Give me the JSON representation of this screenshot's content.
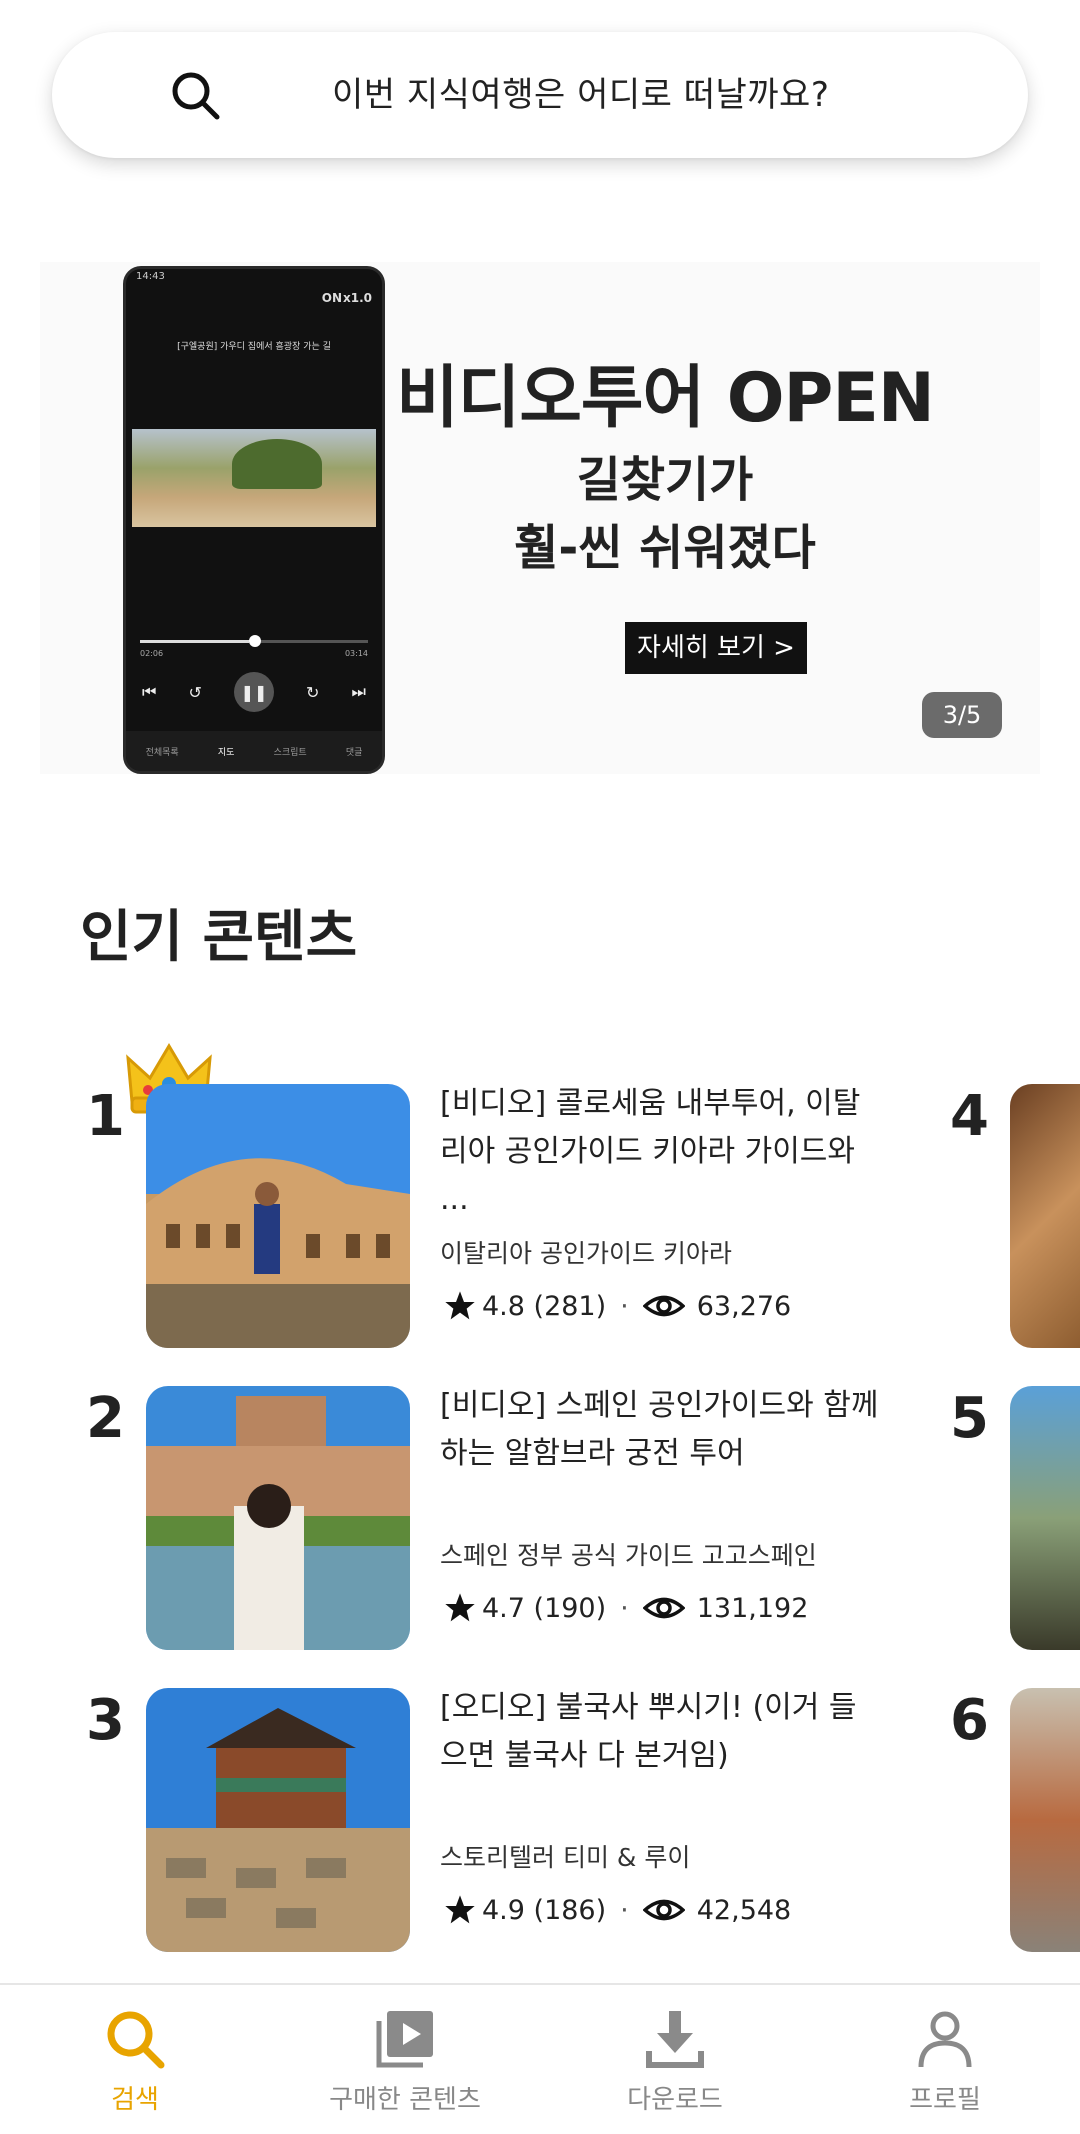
{
  "search": {
    "placeholder": "이번 지식여행은 어디로 떠날까요?"
  },
  "banner": {
    "headline": "비디오투어 OPEN",
    "subline1": "길찾기가",
    "subline2": "훨-씬 쉬워졌다",
    "cta": "자세히 보기 >",
    "counter": "3/5",
    "phone": {
      "status": "14:43",
      "toggle": "ON",
      "speed": "x1.0",
      "video_title": "[구엘공원] 가우디 집에서 흠광장 가는 길",
      "time_start": "02:06",
      "time_end": "03:14",
      "tabs": [
        "전체목록",
        "지도",
        "스크립트",
        "댓글"
      ]
    }
  },
  "section": {
    "title": "인기 콘텐츠"
  },
  "items": [
    {
      "rank": "1",
      "title": "[비디오] 콜로세움 내부투어, 이탈리아 공인가이드 키아라 가이드와 ...",
      "creator": "이탈리아 공인가이드  키아라",
      "rating": "4.8",
      "reviews": "(281)",
      "views": "63,276"
    },
    {
      "rank": "2",
      "title": "[비디오] 스페인 공인가이드와 함께하는 알함브라 궁전 투어",
      "creator": "스페인 정부 공식 가이드  고고스페인",
      "rating": "4.7",
      "reviews": "(190)",
      "views": "131,192"
    },
    {
      "rank": "3",
      "title": "[오디오] 불국사 뿌시기! (이거 들으면 불국사 다 본거임)",
      "creator": "스토리텔러  티미 & 루이",
      "rating": "4.9",
      "reviews": "(186)",
      "views": "42,548"
    }
  ],
  "side_ranks": [
    "4",
    "5",
    "6"
  ],
  "nav": [
    {
      "label": "검색",
      "icon": "search-icon",
      "active": true
    },
    {
      "label": "구매한 콘텐츠",
      "icon": "play-library-icon",
      "active": false
    },
    {
      "label": "다운로드",
      "icon": "download-icon",
      "active": false
    },
    {
      "label": "프로필",
      "icon": "person-icon",
      "active": false
    }
  ],
  "colors": {
    "accent": "#e8a400",
    "inactive": "#888888",
    "text": "#222222"
  }
}
